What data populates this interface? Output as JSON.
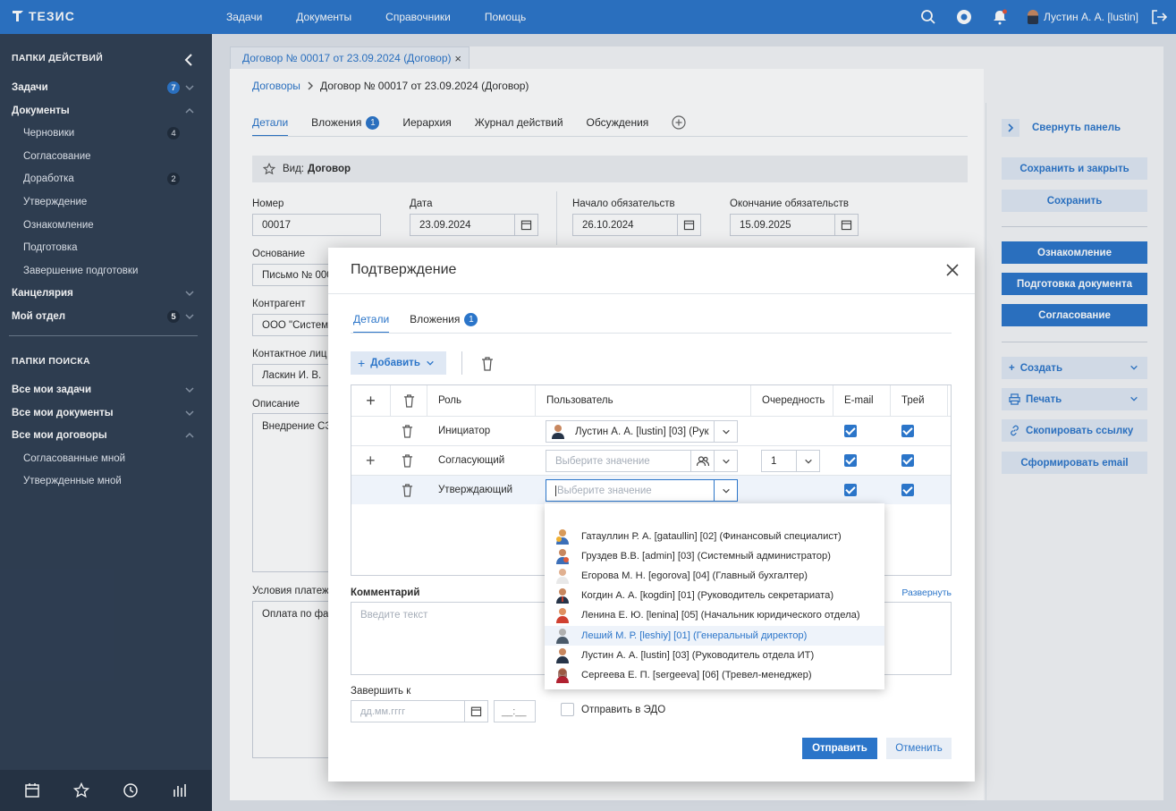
{
  "app": {
    "logo_text": "ТЕЗИС"
  },
  "topnav": [
    "Задачи",
    "Документы",
    "Справочники",
    "Помощь"
  ],
  "user": {
    "name": "Лустин А. А. [lustin]"
  },
  "sidebar": {
    "actions_header": "ПАПКИ ДЕЙСТВИЙ",
    "items": [
      {
        "label": "Задачи",
        "badge": "7"
      },
      {
        "label": "Документы"
      },
      {
        "label": "Черновики",
        "badge": "4"
      },
      {
        "label": "Согласование"
      },
      {
        "label": "Доработка",
        "badge": "2"
      },
      {
        "label": "Утверждение"
      },
      {
        "label": "Ознакомление"
      },
      {
        "label": "Подготовка"
      },
      {
        "label": "Завершение подготовки"
      },
      {
        "label": "Канцелярия"
      },
      {
        "label": "Мой отдел",
        "badge": "5"
      }
    ],
    "search_header": "ПАПКИ ПОИСКА",
    "search_items": [
      {
        "label": "Все мои задачи"
      },
      {
        "label": "Все мои документы"
      },
      {
        "label": "Все мои договоры"
      },
      {
        "label": "Согласованные мной"
      },
      {
        "label": "Утвержденные мной"
      }
    ]
  },
  "doc_tab": {
    "label": "Договор № 00017 от 23.09.2024 (Договор)",
    "close": "×"
  },
  "breadcrumb": {
    "root": "Договоры",
    "current": "Договор № 00017 от 23.09.2024 (Договор)"
  },
  "tabs": [
    {
      "label": "Детали"
    },
    {
      "label": "Вложения",
      "badge": "1"
    },
    {
      "label": "Иерархия"
    },
    {
      "label": "Журнал действий"
    },
    {
      "label": "Обсуждения"
    }
  ],
  "kind": {
    "label": "Вид:",
    "value": "Договор"
  },
  "form": {
    "number_label": "Номер",
    "number": "00017",
    "date_label": "Дата",
    "date": "23.09.2024",
    "start_label": "Начало обязательств",
    "start": "26.10.2024",
    "end_label": "Окончание обязательств",
    "end": "15.09.2025",
    "basis_label": "Основание",
    "basis": "Письмо № 000",
    "counterparty_label": "Контрагент",
    "counterparty": "ООО \"Система",
    "contact_label": "Контактное лиц",
    "contact": "Ласкин И. В.",
    "description_label": "Описание",
    "description": "Внедрение СЭ",
    "payment_label": "Условия платеж",
    "payment": "Оплата по фак"
  },
  "right_panel": {
    "collapse": "Свернуть панель",
    "save_close": "Сохранить и закрыть",
    "save": "Сохранить",
    "acquaint": "Ознакомление",
    "prepare": "Подготовка документа",
    "approve": "Согласование",
    "create": "Создать",
    "print": "Печать",
    "copy_link": "Скопировать ссылку",
    "email": "Сформировать email"
  },
  "modal": {
    "title": "Подтверждение",
    "tabs": [
      {
        "label": "Детали"
      },
      {
        "label": "Вложения",
        "badge": "1"
      }
    ],
    "add_label": "Добавить",
    "columns": {
      "role": "Роль",
      "user": "Пользователь",
      "order": "Очередность",
      "email": "E-mail",
      "tray": "Трей"
    },
    "rows": [
      {
        "role": "Инициатор",
        "user": "Лустин А. А. [lustin] [03] (Рук",
        "order": "",
        "email": true,
        "tray": true
      },
      {
        "role": "Согласующий",
        "user_placeholder": "Выберите значение",
        "order": "1",
        "email": true,
        "tray": true
      },
      {
        "role": "Утверждающий",
        "user_placeholder": "Выберите значение",
        "order": "",
        "email": true,
        "tray": true
      }
    ],
    "dropdown_options": [
      "Гатауллин Р. А. [gataullin] [02] (Финансовый специалист)",
      "Груздев В.В. [admin] [03] (Системный администратор)",
      "Егорова М. Н. [egorova] [04] (Главный бухгалтер)",
      "Когдин А. А. [kogdin] [01] (Руководитель секретариата)",
      "Ленина Е. Ю. [lenina] [05] (Начальник юридического отдела)",
      "Леший М. Р. [leshiy] [01] (Генеральный директор)",
      "Лустин А. А. [lustin] [03] (Руководитель отдела ИТ)",
      "Сергеева Е. П. [sergeeva] [06] (Тревел-менеджер)"
    ],
    "comment_label": "Комментарий",
    "expand": "Развернуть",
    "comment_placeholder": "Введите текст",
    "finish_label": "Завершить к",
    "date_placeholder": "дд.мм.гггг",
    "time_placeholder": "__:__",
    "edo_label": "Отправить в ЭДО",
    "send": "Отправить",
    "cancel": "Отменить"
  },
  "colors": {
    "accent": "#2b75c9",
    "sidebar": "#2f3e52"
  }
}
